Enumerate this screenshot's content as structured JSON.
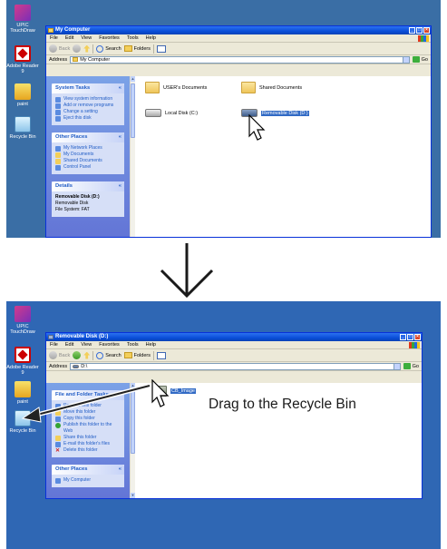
{
  "desktop": {
    "icons": [
      {
        "label": "UPIC TouchDraw"
      },
      {
        "label": "Adobe Reader 9"
      },
      {
        "label": "paint"
      },
      {
        "label": "Recycle Bin"
      }
    ]
  },
  "window1": {
    "title": "My Computer",
    "menu": [
      "File",
      "Edit",
      "View",
      "Favorites",
      "Tools",
      "Help"
    ],
    "toolbar": {
      "back": "Back",
      "search": "Search",
      "folders": "Folders"
    },
    "address": {
      "label": "Address",
      "value": "My Computer",
      "go": "Go"
    },
    "panels": {
      "system_tasks": {
        "title": "System Tasks",
        "items": [
          "View system information",
          "Add or remove programs",
          "Change a setting",
          "Eject this disk"
        ]
      },
      "other_places": {
        "title": "Other Places",
        "items": [
          "My Network Places",
          "My Documents",
          "Shared Documents",
          "Control Panel"
        ]
      },
      "details": {
        "title": "Details",
        "name": "Removable Disk (D:)",
        "type": "Removable Disk",
        "fs": "File System: FAT"
      }
    },
    "items": {
      "user_docs": "USER's Documents",
      "shared_docs": "Shared Documents",
      "local_disk": "Local Disk (C:)",
      "removable": "Removable Disk (D:)"
    }
  },
  "window2": {
    "title": "Removable Disk (D:)",
    "menu": [
      "File",
      "Edit",
      "View",
      "Favorites",
      "Tools",
      "Help"
    ],
    "toolbar": {
      "back": "Back",
      "search": "Search",
      "folders": "Folders"
    },
    "address": {
      "label": "Address",
      "value": "D:\\",
      "go": "Go"
    },
    "panels": {
      "file_folder_tasks": {
        "title": "File and Folder Tasks",
        "items": [
          "Rename this folder",
          "Move this folder",
          "Copy this folder",
          "Publish this folder to the Web",
          "Share this folder",
          "E-mail this folder's files",
          "Delete this folder"
        ]
      },
      "other_places": {
        "title": "Other Places",
        "items": [
          "My Computer"
        ]
      }
    },
    "items": {
      "cb_image": "CB_Image"
    }
  },
  "caption": "Drag to the Recycle Bin",
  "colors": {
    "desktop": "#3a6ea5",
    "titlebar": "#0a4ed8",
    "selection": "#316ac5",
    "arrow": "#1a1a1a"
  }
}
